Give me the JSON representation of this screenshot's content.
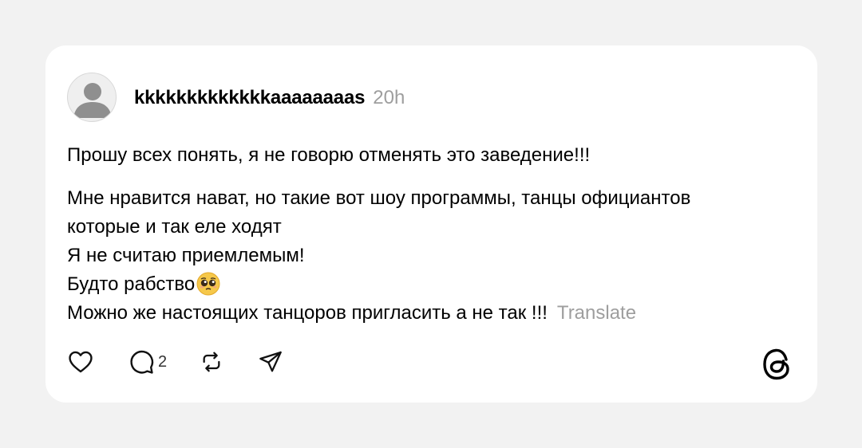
{
  "post": {
    "username": "kkkkkkkkkkkkkaaaaaaaas",
    "timestamp": "20h",
    "paragraph_1": "Прошу всех понять, я не говорю отменять это заведение!!!",
    "lines": [
      "Мне нравится нават, но такие вот шоу программы, танцы официантов",
      "которые и так еле ходят",
      "Я не считаю приемлемым!",
      "Будто рабство",
      "Можно же настоящих танцоров пригласить а не так !!!"
    ],
    "emoji": "pleading-face-emoji",
    "translate_label": "Translate"
  },
  "actions": {
    "like_icon": "heart-icon",
    "reply_icon": "speech-bubble-icon",
    "reply_count": "2",
    "repost_icon": "repost-icon",
    "share_icon": "send-icon"
  },
  "branding": {
    "logo": "threads-logo-icon"
  },
  "colors": {
    "background": "#f2f2f2",
    "card": "#ffffff",
    "text": "#000000",
    "muted": "#9e9e9e"
  }
}
